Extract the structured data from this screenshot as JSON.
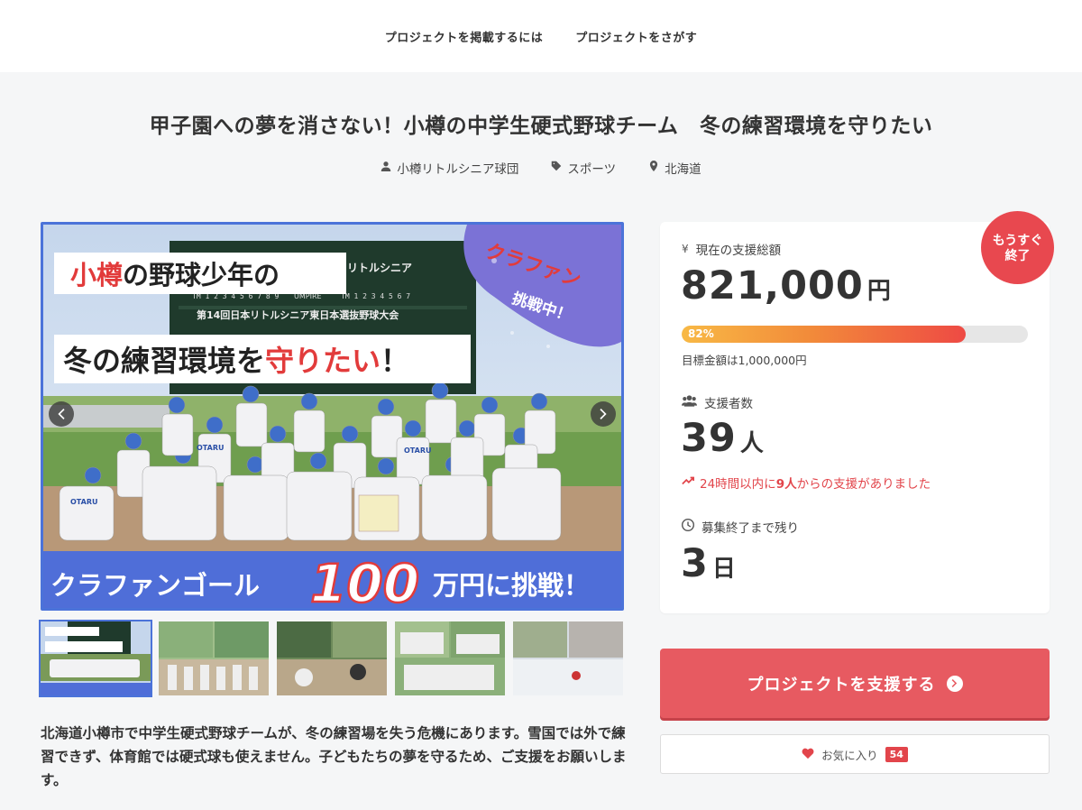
{
  "nav": {
    "items": [
      "プロジェクトを掲載するには",
      "プロジェクトをさがす"
    ]
  },
  "project": {
    "title": "甲子園への夢を消さない！小樽の中学生硬式野球チーム　冬の練習環境を守りたい",
    "owner": "小樽リトルシニア球団",
    "category": "スポーツ",
    "location": "北海道",
    "description": "北海道小樽市で中学生硬式野球チームが、冬の練習場を失う危機にあります。雪国では外で練習できず、体育館では硬式球も使えません。子どもたちの夢を守るため、ご支援をお願いします。"
  },
  "hero": {
    "line1_red": "小樽",
    "line1_rest": "の野球少年の",
    "line2_a": "冬の練習環境を",
    "line2_red": "守りたい",
    "line2_end": "！",
    "stamp_top": "クラファン",
    "stamp_bottom": "挑戦中！",
    "bottom_a": "クラファンゴール",
    "bottom_num": "100",
    "bottom_b": "万円に挑戦！",
    "scoreboard_a": "TM 1 2 3 4 5 6 7 8 9",
    "scoreboard_umpire": "UMPIRE",
    "scoreboard_b": "TM 1 2 3 4 5 6 7",
    "scoreboard_title": "第14回日本リトルシニア東日本選抜野球大会",
    "scoreboard_name": "リトルシニア",
    "jersey": "OTARU"
  },
  "stats": {
    "badge_line1": "もうすぐ",
    "badge_line2": "終了",
    "amount_label": "現在の支援総額",
    "amount": "821,000",
    "amount_unit": "円",
    "progress_label": "82%",
    "progress_value": 0.82,
    "goal": "目標金額は1,000,000円",
    "backers_label": "支援者数",
    "backers": "39",
    "backers_unit": "人",
    "recent_a": "24時間以内に",
    "recent_num": "9人",
    "recent_b": "からの支援がありました",
    "remaining_label": "募集終了まで残り",
    "remaining": "3",
    "remaining_unit": "日"
  },
  "actions": {
    "support_label": "プロジェクトを支援する",
    "favorite_label": "お気に入り",
    "favorite_count": "54"
  },
  "icons": {
    "owner": "user-icon",
    "category": "tag-icon",
    "location": "map-pin-icon",
    "amount": "yen-icon",
    "backers": "users-icon",
    "recent": "trending-up-icon",
    "remaining": "clock-icon",
    "favorite": "heart-icon",
    "support": "chevron-right-circle-icon"
  },
  "colors": {
    "accent": "#e75a61",
    "badge": "#e8484f",
    "image_border": "#4b73d9"
  }
}
